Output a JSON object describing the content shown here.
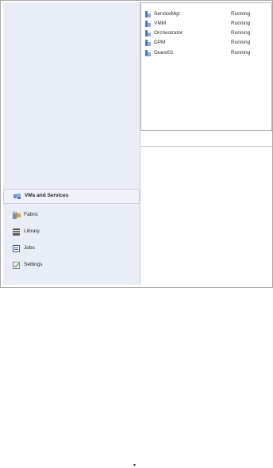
{
  "vm_list": [
    {
      "name": "ServiceMgr",
      "status": "Running"
    },
    {
      "name": "VMM",
      "status": "Running"
    },
    {
      "name": "Orchestrator",
      "status": "Running"
    },
    {
      "name": "DPM",
      "status": "Running"
    },
    {
      "name": "Guest01",
      "status": "Running"
    }
  ],
  "nav": {
    "items": [
      {
        "label": "VMs and Services",
        "icon": "vms-and-services-icon",
        "selected": true
      },
      {
        "label": "Fabric",
        "icon": "fabric-icon",
        "selected": false
      },
      {
        "label": "Library",
        "icon": "library-icon",
        "selected": false
      },
      {
        "label": "Jobs",
        "icon": "jobs-icon",
        "selected": false
      },
      {
        "label": "Settings",
        "icon": "settings-icon",
        "selected": false
      }
    ],
    "scroll_icon": "chevron-down-icon"
  },
  "colors": {
    "nav_bg": "#e8edf6",
    "selected_bg": "#eef1f7",
    "vm_icon": "#4a78b8"
  }
}
